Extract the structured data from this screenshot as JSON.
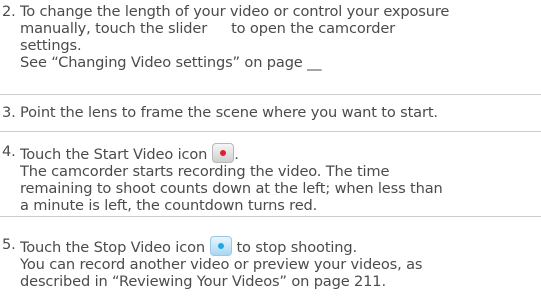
{
  "steps": [
    {
      "number": "2.",
      "lines": [
        "To change the length of your video or control your exposure",
        "manually, touch the slider",
        "to open the camcorder",
        "settings.",
        "See “Changing Video settings” on page __"
      ]
    },
    {
      "number": "3.",
      "lines": [
        "Point the lens to frame the scene where you want to start."
      ]
    },
    {
      "number": "4.",
      "lines": [
        "Touch the Start Video icon",
        ".",
        "The camcorder starts recording the video. The time",
        "remaining to shoot counts down at the left; when less than",
        "a minute is left, the countdown turns red."
      ]
    },
    {
      "number": "5.",
      "lines": [
        "Touch the Stop Video icon",
        "to stop shooting.",
        "You can record another video or preview your videos, as",
        "described in “Reviewing Your Videos” on page 211."
      ]
    }
  ],
  "icons": {
    "start_video": "record-start-icon",
    "stop_video": "record-stop-icon",
    "start_dot_color": "#e0202a",
    "stop_dot_color": "#1ea7e8"
  }
}
